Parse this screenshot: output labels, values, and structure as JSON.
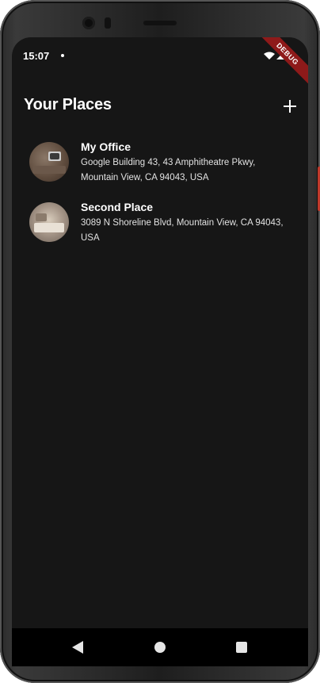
{
  "status_bar": {
    "time": "15:07",
    "debug_label": "DEBUG"
  },
  "app_bar": {
    "title": "Your Places",
    "add_icon": "plus-icon"
  },
  "places": [
    {
      "title": "My Office",
      "address": "Google Building 43, 43 Amphitheatre Pkwy, Mountain View, CA 94043, USA"
    },
    {
      "title": "Second Place",
      "address": "3089 N Shoreline Blvd, Mountain View, CA 94043, USA"
    }
  ],
  "nav_bar": {
    "back_icon": "triangle-back-icon",
    "home_icon": "circle-home-icon",
    "recents_icon": "square-recents-icon"
  },
  "colors": {
    "background": "#161616",
    "text": "#ffffff",
    "debug_ribbon": "#8e1a1a"
  }
}
